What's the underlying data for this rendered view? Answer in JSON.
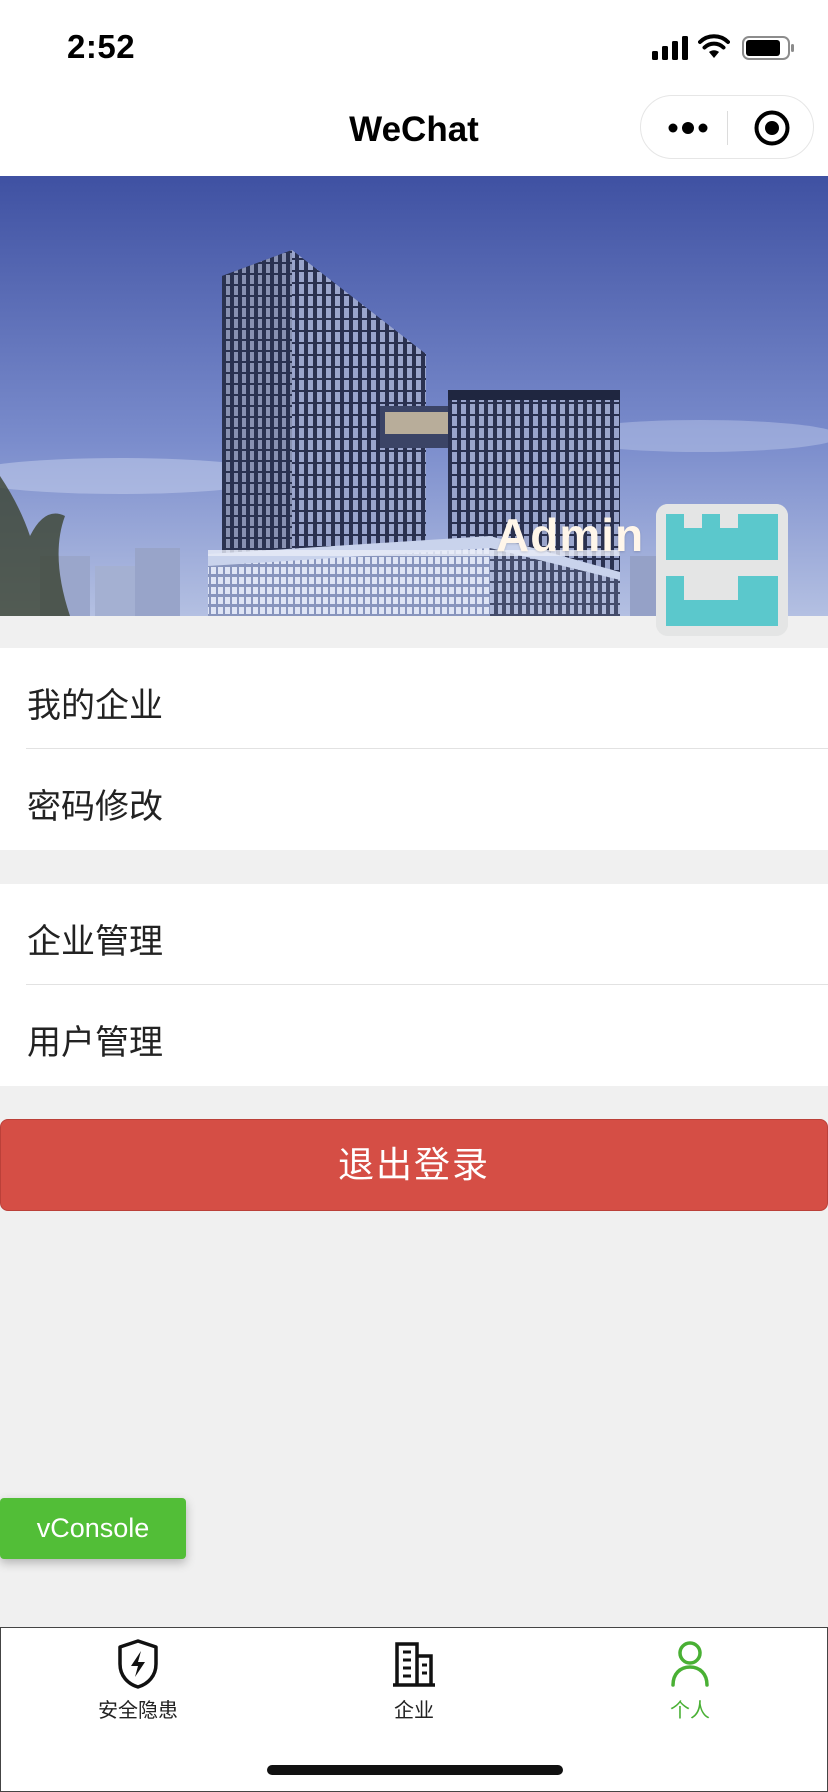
{
  "status_bar": {
    "time": "2:52"
  },
  "nav": {
    "title": "WeChat"
  },
  "profile": {
    "username": "Admin"
  },
  "menu_groups": [
    {
      "items": [
        {
          "label": "我的企业"
        },
        {
          "label": "密码修改"
        }
      ]
    },
    {
      "items": [
        {
          "label": "企业管理"
        },
        {
          "label": "用户管理"
        }
      ]
    }
  ],
  "logout_label": "退出登录",
  "vconsole_label": "vConsole",
  "tab_bar": {
    "active_index": 2,
    "items": [
      {
        "label": "安全隐患",
        "icon": "shield-bolt-icon"
      },
      {
        "label": "企业",
        "icon": "building-icon"
      },
      {
        "label": "个人",
        "icon": "user-icon"
      }
    ]
  },
  "colors": {
    "accent_green": "#49b034",
    "logout_red": "#d54e45",
    "vconsole_green": "#52be37",
    "avatar_teal": "#5bc8cc"
  }
}
